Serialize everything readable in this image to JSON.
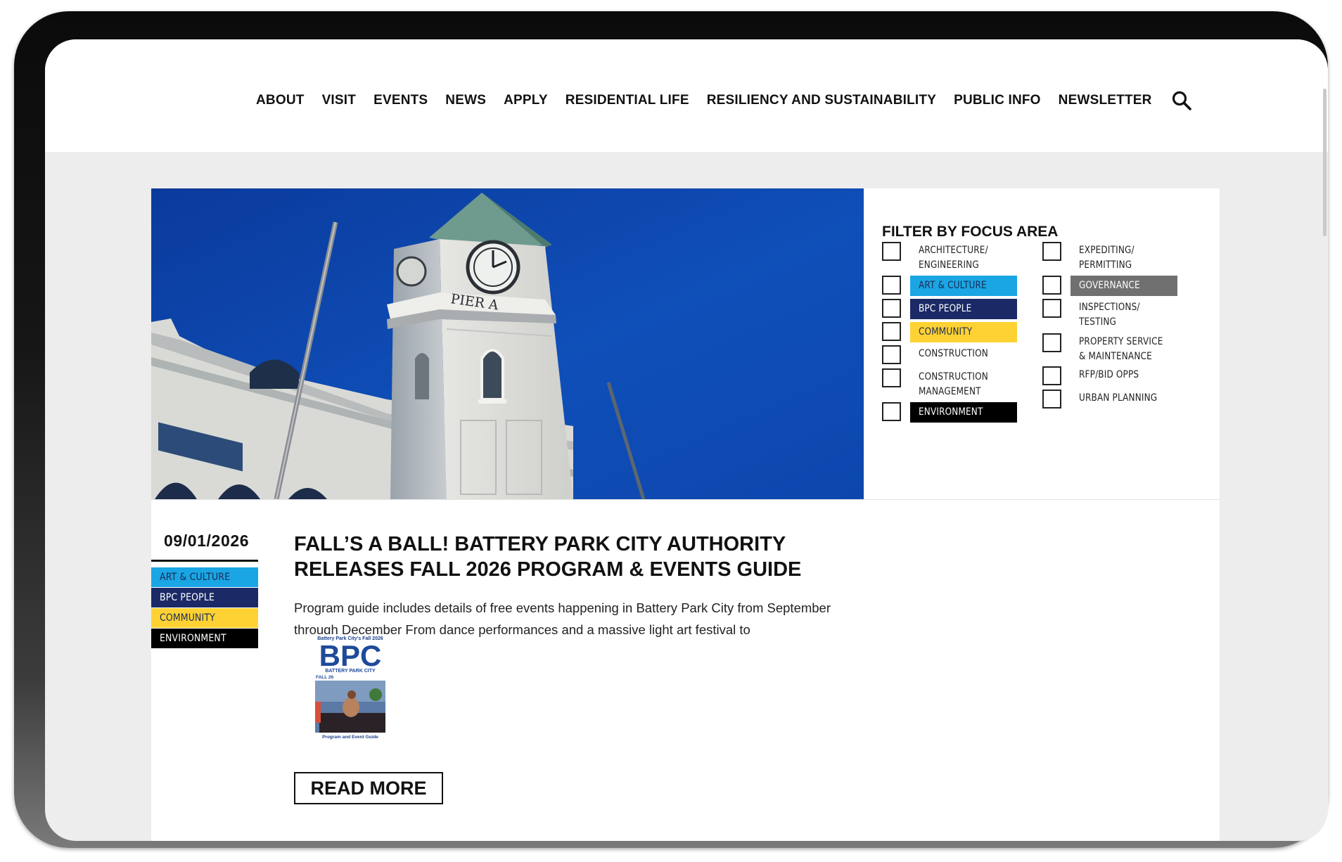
{
  "nav": {
    "items": [
      "ABOUT",
      "VISIT",
      "EVENTS",
      "NEWS",
      "APPLY",
      "RESIDENTIAL LIFE",
      "RESILIENCY AND SUSTAINABILITY",
      "PUBLIC INFO",
      "NEWSLETTER"
    ],
    "search_icon": "search-icon"
  },
  "hero": {
    "tower_sign": "PIER A"
  },
  "filter": {
    "title": "FILTER BY FOCUS AREA",
    "left": [
      {
        "label": "ARCHITECTURE/ ENGINEERING",
        "style": "plain"
      },
      {
        "label": "ART & CULTURE",
        "style": "chip",
        "bg": "#1aa6e4",
        "fg": "#1b2a55"
      },
      {
        "label": "BPC PEOPLE",
        "style": "chip",
        "bg": "#1b2a66",
        "fg": "#ffffff"
      },
      {
        "label": "COMMUNITY",
        "style": "chip",
        "bg": "#fed233",
        "fg": "#1b2a55"
      },
      {
        "label": "CONSTRUCTION",
        "style": "plain"
      },
      {
        "label": "CONSTRUCTION MANAGEMENT",
        "style": "plain"
      },
      {
        "label": "ENVIRONMENT",
        "style": "chip",
        "bg": "#000000",
        "fg": "#ffffff"
      }
    ],
    "right": [
      {
        "label": "EXPEDITING/ PERMITTING",
        "style": "plain"
      },
      {
        "label": "GOVERNANCE",
        "style": "chip",
        "bg": "#707070",
        "fg": "#ffffff"
      },
      {
        "label": "INSPECTIONS/ TESTING",
        "style": "plain"
      },
      {
        "label": "PROPERTY SERVICE & MAINTENANCE",
        "style": "plain"
      },
      {
        "label": "RFP/BID OPPS",
        "style": "plain"
      },
      {
        "label": "URBAN PLANNING",
        "style": "plain"
      }
    ]
  },
  "article": {
    "date": "09/01/2026",
    "tags": [
      {
        "label": "ART & CULTURE",
        "bg": "#1aa6e4",
        "fg": "#1b2a55"
      },
      {
        "label": "BPC PEOPLE",
        "bg": "#1b2a66",
        "fg": "#ffffff"
      },
      {
        "label": "COMMUNITY",
        "bg": "#fed233",
        "fg": "#1b2a55"
      },
      {
        "label": "ENVIRONMENT",
        "bg": "#000000",
        "fg": "#ffffff"
      }
    ],
    "headline": "FALL’S A BALL! BATTERY PARK CITY AUTHORITY RELEASES FALL 2026 PROGRAM & EVENTS GUIDE",
    "excerpt": "Program guide includes details of free events happening in Battery Park City from September through December From dance performances and a massive light art festival to",
    "guide_cover": {
      "top_line": "Battery Park City's Fall 2026",
      "big": "BPC",
      "sub": "BATTERY PARK CITY",
      "season": "FALL 26",
      "bottom": "Program and Event Guide"
    },
    "read_more": "READ MORE"
  }
}
